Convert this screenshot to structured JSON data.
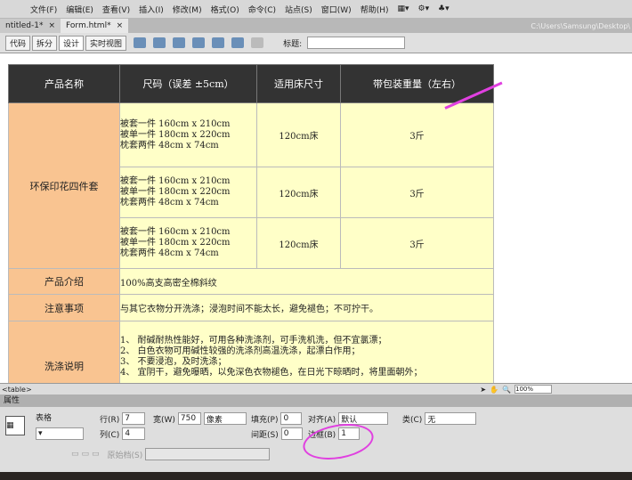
{
  "menu": [
    "文件(F)",
    "编辑(E)",
    "查看(V)",
    "插入(I)",
    "修改(M)",
    "格式(O)",
    "命令(C)",
    "站点(S)",
    "窗口(W)",
    "帮助(H)"
  ],
  "tabs": [
    {
      "label": "ntitled-1*"
    },
    {
      "label": "Form.html*"
    }
  ],
  "path": "C:\\Users\\Samsung\\Desktop\\",
  "toolbar": {
    "views": [
      "代码",
      "拆分",
      "设计",
      "实时视图"
    ],
    "title_label": "标题:",
    "title_value": ""
  },
  "table": {
    "headers": [
      "产品名称",
      "尺码（误差 ±5cm）",
      "适用床尺寸",
      "带包装重量（左右）"
    ],
    "product": "环保印花四件套",
    "sizes": [
      "被套一件 160cm x 210cm",
      "被单一件 180cm x 220cm",
      "枕套两件 48cm x 74cm"
    ],
    "bed": "120cm床",
    "weight": "3斤",
    "intro_label": "产品介绍",
    "intro": "100%高支高密全棉斜纹",
    "note_label": "注意事项",
    "note": "与其它衣物分开洗涤；浸泡时间不能太长，避免褪色；不可拧干。",
    "wash_label": "洗涤说明",
    "wash": [
      "1、 耐碱耐热性能好，可用各种洗涤剂，可手洗机洗，但不宜氯漂；",
      "2、 白色衣物可用碱性较强的洗涤剂高温洗涤，起漂白作用；",
      "3、 不要浸泡，及时洗涤；",
      "4、 宜阴干，避免曝晒，以免深色衣物褪色，在日光下晾晒时，将里面朝外；"
    ]
  },
  "tagbar": {
    "tag": "<table>",
    "zoom": "100%"
  },
  "props": {
    "title": "属性",
    "kind": "表格",
    "rows_label": "行(R)",
    "rows": "7",
    "cols_label": "列(C)",
    "cols": "4",
    "width_label": "宽(W)",
    "width": "750",
    "unit": "像素",
    "pad_label": "填充(P)",
    "pad": "0",
    "space_label": "间距(S)",
    "space": "0",
    "align_label": "对齐(A)",
    "align": "默认",
    "border_label": "边框(B)",
    "border": "1",
    "class_label": "类(C)",
    "class": "无",
    "src_label": "原始档(S)"
  },
  "accent": "#e040e0"
}
